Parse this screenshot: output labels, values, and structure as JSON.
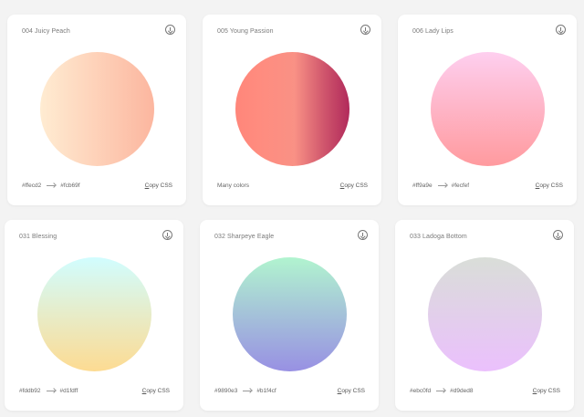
{
  "cards": [
    {
      "title": "004 Juicy Peach",
      "colors": {
        "from": "#ffecd2",
        "to": "#fcb69f"
      },
      "direction": "to right",
      "footer_from": "#ffecd2",
      "footer_to": "#fcb69f",
      "copy_first": "C",
      "copy_rest": "opy CSS"
    },
    {
      "title": "005 Young Passion",
      "colors_stops": [
        "#ff8177 0%",
        "#ff867a 0%",
        "#ff8c7f 21%",
        "#f99185 52%",
        "#cf556c 78%",
        "#b12a5b 100%"
      ],
      "direction": "to right",
      "footer_text": "Many colors",
      "copy_first": "C",
      "copy_rest": "opy CSS"
    },
    {
      "title": "006 Lady Lips",
      "colors": {
        "from": "#ff9a9e",
        "to": "#fecfef"
      },
      "direction": "to top",
      "footer_from": "#ff9a9e",
      "footer_to": "#fecfef",
      "copy_first": "C",
      "copy_rest": "opy CSS"
    },
    {
      "title": "031 Blessing",
      "colors": {
        "from": "#fddb92",
        "to": "#d1fdff"
      },
      "direction": "to top",
      "footer_from": "#fddb92",
      "footer_to": "#d1fdff",
      "copy_first": "C",
      "copy_rest": "opy CSS"
    },
    {
      "title": "032 Sharpeye Eagle",
      "colors": {
        "from": "#9890e3",
        "to": "#b1f4cf"
      },
      "direction": "to top",
      "footer_from": "#9890e3",
      "footer_to": "#b1f4cf",
      "copy_first": "C",
      "copy_rest": "opy CSS"
    },
    {
      "title": "033 Ladoga Bottom",
      "colors": {
        "from": "#ebc0fd",
        "to": "#d9ded8"
      },
      "direction": "to top",
      "footer_from": "#ebc0fd",
      "footer_to": "#d9ded8",
      "copy_first": "C",
      "copy_rest": "opy CSS"
    }
  ]
}
